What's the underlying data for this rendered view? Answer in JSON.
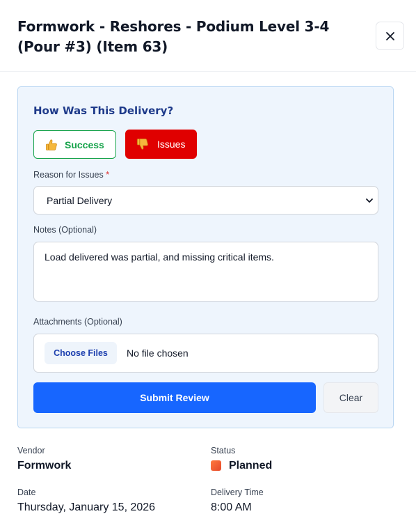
{
  "header": {
    "title": "Formwork - Reshores - Podium Level 3-4 (Pour #3) (Item 63)",
    "close_icon": "close-icon"
  },
  "review": {
    "heading": "How Was This Delivery?",
    "success_label": "Success",
    "success_icon": "thumbs-up-icon",
    "issues_label": "Issues",
    "issues_icon": "thumbs-down-icon",
    "issues_selected": true,
    "reason_label": "Reason for Issues",
    "required_marker": "*",
    "reason_value": "Partial Delivery",
    "notes_label": "Notes (Optional)",
    "notes_value": "Load delivered was partial, and missing critical items.",
    "attachments_label": "Attachments (Optional)",
    "choose_files_label": "Choose Files",
    "no_file_text": "No file chosen",
    "submit_label": "Submit Review",
    "clear_label": "Clear"
  },
  "details": {
    "vendor_label": "Vendor",
    "vendor_value": "Formwork",
    "status_label": "Status",
    "status_value": "Planned",
    "date_label": "Date",
    "date_value": "Thursday, January 15, 2026",
    "time_label": "Delivery Time",
    "time_value": "8:00 AM"
  },
  "colors": {
    "accent_blue": "#1766ff",
    "success_green": "#16a34a",
    "issues_red": "#e00000",
    "panel_bg": "#eef5fd",
    "status_orange": "#f05a2a"
  }
}
